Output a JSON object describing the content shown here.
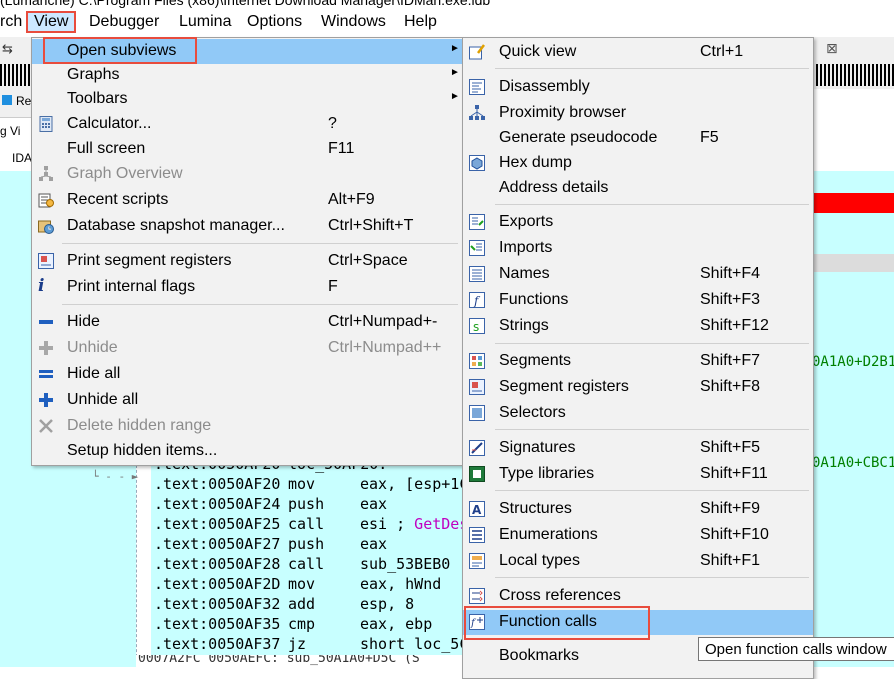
{
  "window_title": "(Lumanche) C:\\Program Files (x86)\\Internet Download Manager\\IDMan.exe.idb",
  "menubar": [
    {
      "label": "rch"
    },
    {
      "label": "View"
    },
    {
      "label": "Debugger"
    },
    {
      "label": "Lumina"
    },
    {
      "label": "Options"
    },
    {
      "label": "Windows"
    },
    {
      "label": "Help"
    }
  ],
  "tabs": {
    "re_label": "Re",
    "sub_label": "g Vi",
    "ida_label": "IDA"
  },
  "code_lines": [
    {
      "addr": ".text:0050AF20",
      "mn": "loc_50AF20:",
      "op": ""
    },
    {
      "addr": ".text:0050AF20",
      "mn": "mov",
      "op": "eax, [esp+1Ch"
    },
    {
      "addr": ".text:0050AF24",
      "mn": "push",
      "op": "eax"
    },
    {
      "addr": ".text:0050AF25",
      "mn": "call",
      "op": "esi ;",
      "cm": " GetDes"
    },
    {
      "addr": ".text:0050AF27",
      "mn": "push",
      "op": "eax"
    },
    {
      "addr": ".text:0050AF28",
      "mn": "call",
      "op": "sub_53BEB0"
    },
    {
      "addr": ".text:0050AF2D",
      "mn": "mov",
      "op": "eax, hWnd"
    },
    {
      "addr": ".text:0050AF32",
      "mn": "add",
      "op": "esp, 8"
    },
    {
      "addr": ".text:0050AF35",
      "mn": "cmp",
      "op": "eax, ebp"
    },
    {
      "addr": ".text:0050AF37",
      "mn": "jz",
      "op": "short loc_5C"
    }
  ],
  "status_text": "0007A2FC 0050AEFC: sub_50A1A0+D5C (S",
  "right_code": [
    "0A1A0+D2B1",
    "0A1A0+CBC1"
  ],
  "view_menu": {
    "items": [
      {
        "label": "Open subviews",
        "shortcut": "",
        "submenu": true,
        "icon": ""
      },
      {
        "label": "Graphs",
        "shortcut": "",
        "submenu": true,
        "icon": ""
      },
      {
        "label": "Toolbars",
        "shortcut": "",
        "submenu": true,
        "icon": ""
      },
      {
        "label": "Calculator...",
        "shortcut": "?",
        "icon": "calculator-icon"
      },
      {
        "label": "Full screen",
        "shortcut": "F11",
        "icon": ""
      },
      {
        "label": "Graph Overview",
        "shortcut": "",
        "disabled": true,
        "icon": "graph-overview-icon"
      },
      {
        "label": "Recent scripts",
        "shortcut": "Alt+F9",
        "icon": "recent-scripts-icon"
      },
      {
        "label": "Database snapshot manager...",
        "shortcut": "Ctrl+Shift+T",
        "icon": "snapshot-manager-icon"
      },
      {
        "label": "Print segment registers",
        "shortcut": "Ctrl+Space",
        "icon": "print-segment-registers-icon"
      },
      {
        "label": "Print internal flags",
        "shortcut": "F",
        "icon": "info-icon"
      },
      {
        "label": "Hide",
        "shortcut": "Ctrl+Numpad+-",
        "icon": "hide-icon"
      },
      {
        "label": "Unhide",
        "shortcut": "Ctrl+Numpad++",
        "disabled": true,
        "icon": "unhide-icon"
      },
      {
        "label": "Hide all",
        "shortcut": "",
        "icon": "hide-all-icon"
      },
      {
        "label": "Unhide all",
        "shortcut": "",
        "icon": "unhide-all-icon"
      },
      {
        "label": "Delete hidden range",
        "shortcut": "",
        "disabled": true,
        "icon": "delete-icon"
      },
      {
        "label": "Setup hidden items...",
        "shortcut": "",
        "icon": ""
      }
    ]
  },
  "subviews_menu": {
    "items": [
      {
        "label": "Quick view",
        "shortcut": "Ctrl+1",
        "icon": "quick-view-icon"
      },
      {
        "label": "Disassembly",
        "shortcut": "",
        "icon": "disassembly-icon"
      },
      {
        "label": "Proximity browser",
        "shortcut": "",
        "icon": "proximity-browser-icon"
      },
      {
        "label": "Generate pseudocode",
        "shortcut": "F5",
        "icon": ""
      },
      {
        "label": "Hex dump",
        "shortcut": "",
        "icon": "hex-dump-icon"
      },
      {
        "label": "Address details",
        "shortcut": "",
        "icon": ""
      },
      {
        "label": "Exports",
        "shortcut": "",
        "icon": "exports-icon"
      },
      {
        "label": "Imports",
        "shortcut": "",
        "icon": "imports-icon"
      },
      {
        "label": "Names",
        "shortcut": "Shift+F4",
        "icon": "names-icon"
      },
      {
        "label": "Functions",
        "shortcut": "Shift+F3",
        "icon": "functions-icon"
      },
      {
        "label": "Strings",
        "shortcut": "Shift+F12",
        "icon": "strings-icon"
      },
      {
        "label": "Segments",
        "shortcut": "Shift+F7",
        "icon": "segments-icon"
      },
      {
        "label": "Segment registers",
        "shortcut": "Shift+F8",
        "icon": "segment-registers-icon"
      },
      {
        "label": "Selectors",
        "shortcut": "",
        "icon": "selectors-icon"
      },
      {
        "label": "Signatures",
        "shortcut": "Shift+F5",
        "icon": "signatures-icon"
      },
      {
        "label": "Type libraries",
        "shortcut": "Shift+F11",
        "icon": "type-libraries-icon"
      },
      {
        "label": "Structures",
        "shortcut": "Shift+F9",
        "icon": "structures-icon"
      },
      {
        "label": "Enumerations",
        "shortcut": "Shift+F10",
        "icon": "enumerations-icon"
      },
      {
        "label": "Local types",
        "shortcut": "Shift+F1",
        "icon": "local-types-icon"
      },
      {
        "label": "Cross references",
        "shortcut": "",
        "icon": "cross-references-icon"
      },
      {
        "label": "Function calls",
        "shortcut": "",
        "icon": "function-calls-icon"
      },
      {
        "label": "Bookmarks",
        "shortcut": "Ctrl+Shift+M",
        "icon": ""
      }
    ]
  },
  "tooltip": "Open function calls window",
  "colors": {
    "highlight_red": "#e84c3d",
    "selection": "#91c9f7",
    "code_background": "#c8ffff"
  }
}
